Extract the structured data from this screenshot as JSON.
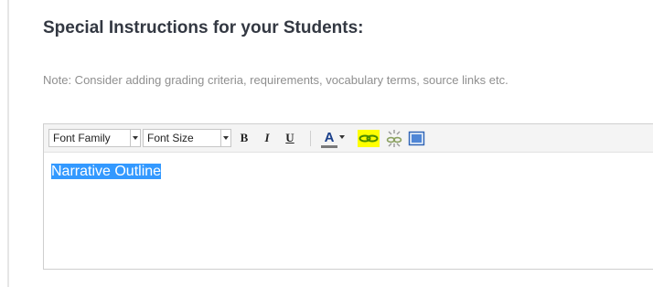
{
  "section": {
    "heading": "Special Instructions for your Students:",
    "note": "Note: Consider adding grading criteria, requirements, vocabulary terms, source links etc."
  },
  "editor": {
    "toolbar": {
      "font_family_label": "Font Family",
      "font_size_label": "Font Size",
      "bold_label": "B",
      "italic_label": "I",
      "underline_label": "U",
      "text_color_label": "A",
      "icons": [
        "bold-icon",
        "italic-icon",
        "underline-icon",
        "text-color-icon",
        "insert-link-icon",
        "unlink-icon",
        "insert-media-icon"
      ],
      "highlight_color": "#ffff00",
      "text_color_underline": "#7a7a7a"
    },
    "content": {
      "text": "Narrative Outline",
      "selection_color": "#3399ff"
    }
  }
}
